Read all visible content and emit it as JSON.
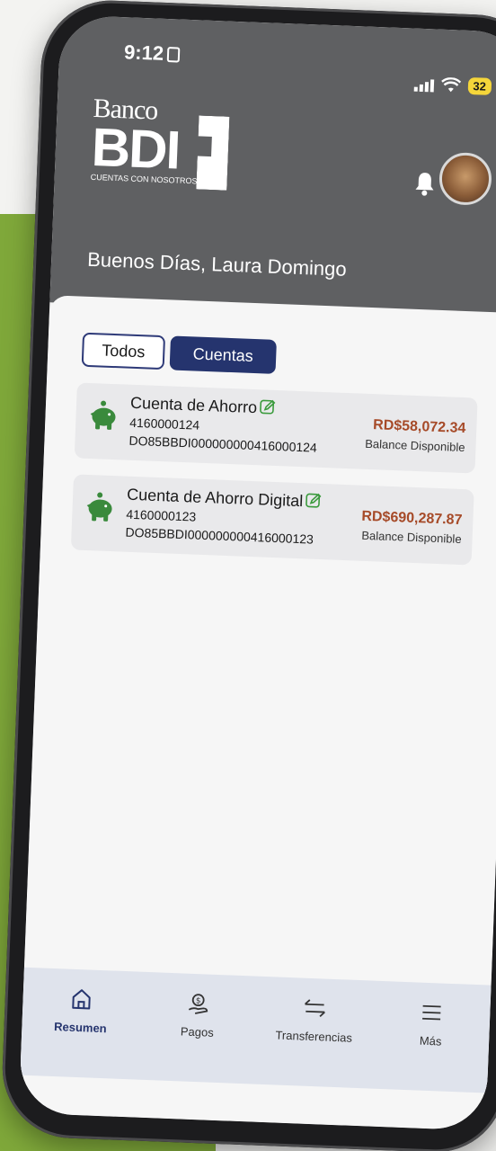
{
  "status_bar": {
    "time": "9:12",
    "battery": "32"
  },
  "brand": {
    "banco": "Banco",
    "bdi": "BDI",
    "tagline": "CUENTAS CON NOSOTROS"
  },
  "greeting": "Buenos Días, Laura Domingo",
  "tabs": [
    {
      "label": "Todos",
      "active": false
    },
    {
      "label": "Cuentas",
      "active": true
    }
  ],
  "accounts": [
    {
      "name": "Cuenta de Ahorro",
      "number": "4160000124",
      "iban": "DO85BBDI000000000416000124",
      "balance": "RD$58,072.34",
      "balance_label": "Balance Disponible"
    },
    {
      "name": "Cuenta de Ahorro Digital",
      "number": "4160000123",
      "iban": "DO85BBDI000000000416000123",
      "balance": "RD$690,287.87",
      "balance_label": "Balance Disponible"
    }
  ],
  "bottom_nav": [
    {
      "label": "Resumen",
      "icon": "home-icon",
      "active": true
    },
    {
      "label": "Pagos",
      "icon": "money-hand-icon",
      "active": false
    },
    {
      "label": "Transferencias",
      "icon": "transfer-arrows-icon",
      "active": false
    },
    {
      "label": "Más",
      "icon": "menu-icon",
      "active": false
    }
  ],
  "colors": {
    "header": "#5f6062",
    "accent_navy": "#25346e",
    "balance": "#a64a28",
    "piggy_green": "#3a8a3c",
    "background_green": "#7fa83a"
  }
}
